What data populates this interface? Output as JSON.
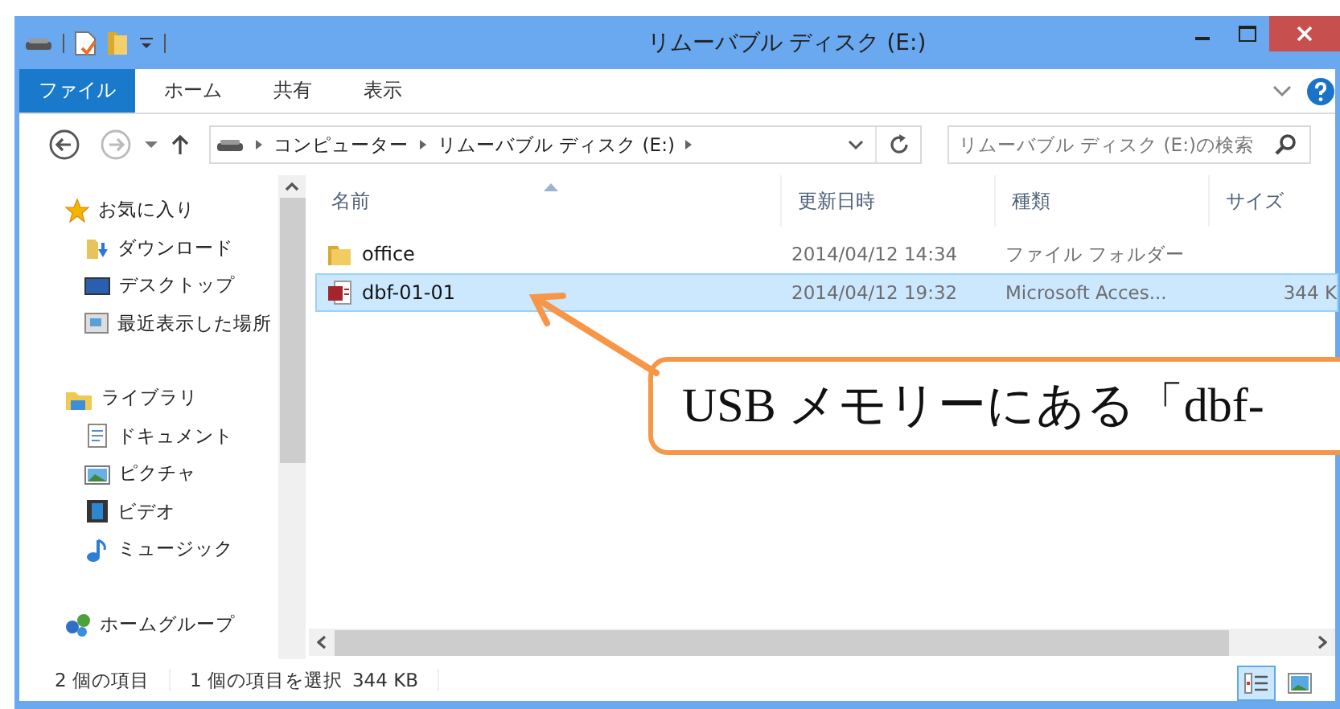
{
  "window": {
    "title": "リムーバブル ディスク (E:)"
  },
  "ribbon_tabs": [
    {
      "label": "ファイル",
      "selected": true
    },
    {
      "label": "ホーム",
      "selected": false
    },
    {
      "label": "共有",
      "selected": false
    },
    {
      "label": "表示",
      "selected": false
    }
  ],
  "address": {
    "path": [
      "コンピューター",
      "リムーバブル ディスク (E:)"
    ]
  },
  "search": {
    "placeholder": "リムーバブル ディスク (E:)の検索"
  },
  "sidebar": {
    "groups": [
      {
        "label": "お気に入り",
        "kind": "favorites",
        "children": [
          {
            "label": "ダウンロード",
            "kind": "downloads"
          },
          {
            "label": "デスクトップ",
            "kind": "desktop"
          },
          {
            "label": "最近表示した場所",
            "kind": "recent"
          }
        ]
      },
      {
        "label": "ライブラリ",
        "kind": "libraries",
        "children": [
          {
            "label": "ドキュメント",
            "kind": "documents"
          },
          {
            "label": "ピクチャ",
            "kind": "pictures"
          },
          {
            "label": "ビデオ",
            "kind": "videos"
          },
          {
            "label": "ミュージック",
            "kind": "music"
          }
        ]
      },
      {
        "label": "ホームグループ",
        "kind": "homegroup"
      }
    ]
  },
  "table": {
    "columns": [
      "名前",
      "更新日時",
      "種類",
      "サイズ"
    ],
    "rows": [
      {
        "kind": "folder",
        "name": "office",
        "modified": "2014/04/12 14:34",
        "type": "ファイル フォルダー",
        "selected": false
      },
      {
        "kind": "access",
        "name": "dbf-01-01",
        "modified": "2014/04/12 19:32",
        "type": "Microsoft Acces...",
        "size": "344 K",
        "selected": true
      }
    ]
  },
  "status_bar": {
    "item_count": "2 個の項目",
    "selection": "1 個の項目を選択",
    "selection_size": "344 KB"
  },
  "view_buttons": [
    {
      "kind": "details",
      "selected": true
    },
    {
      "kind": "large-icons",
      "selected": false
    }
  ],
  "callout": {
    "text": "USB メモリーにある「dbf-"
  }
}
